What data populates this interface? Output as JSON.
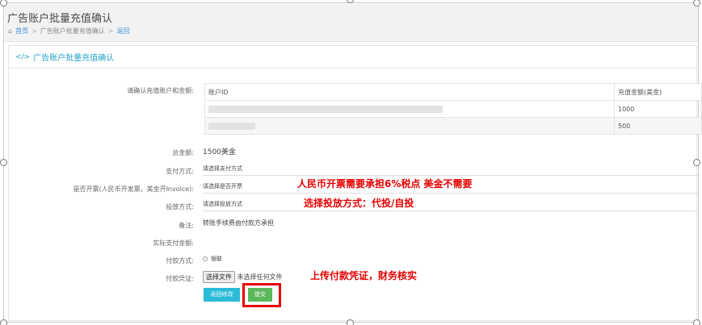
{
  "header": {
    "title": "广告账户批量充值确认",
    "breadcrumb": {
      "home": "首页",
      "current": "广告账户批量充值确认",
      "back": "返回"
    }
  },
  "panel": {
    "title": "广告账户批量充值确认"
  },
  "form": {
    "confirm_label": "请确认充值账户和金额:",
    "table": {
      "headers": [
        "账户ID",
        "充值金额(美金)"
      ],
      "rows": [
        {
          "amount": "1000"
        },
        {
          "amount": "500"
        }
      ]
    },
    "total_label": "总金额:",
    "total_value": "1500美金",
    "pay_method_label": "支付方式:",
    "pay_method_placeholder": "请选择支付方式",
    "invoice_label": "是否开票(人民币开发票，美金开Invoice):",
    "invoice_placeholder": "请选择是否开票",
    "delivery_label": "投放方式:",
    "delivery_placeholder": "请选择投放方式",
    "note_label": "备注:",
    "note_value": "转账手续费由付款方承担",
    "actual_pay_label": "实际支付金额:",
    "payment_type_label": "付款方式:",
    "payment_type_option": "银联",
    "voucher_label": "付款凭证:",
    "file_button": "选择文件",
    "file_status": "未选择任何文件",
    "return_button": "返回修改",
    "submit_button": "提交"
  },
  "annotations": {
    "invoice_note": "人民币开票需要承担6%税点 美金不需要",
    "delivery_note": "选择投放方式：代投/自投",
    "voucher_note": "上传付款凭证，财务核实"
  },
  "colors": {
    "accent": "#26a2c7",
    "return_btn": "#2bbbd8",
    "submit_btn": "#5cb85c",
    "annotation": "#e60000"
  }
}
